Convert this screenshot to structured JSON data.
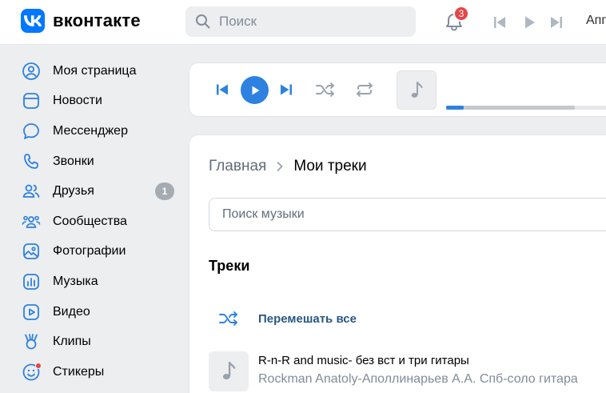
{
  "brand": {
    "name": "вконтакте",
    "accent": "#0077ff"
  },
  "header": {
    "search_placeholder": "Поиск",
    "notifications_count": "3",
    "app_label": "Апп"
  },
  "sidebar": {
    "items": [
      {
        "label": "Моя страница",
        "icon": "user-circle-icon"
      },
      {
        "label": "Новости",
        "icon": "news-icon"
      },
      {
        "label": "Мессенджер",
        "icon": "message-icon"
      },
      {
        "label": "Звонки",
        "icon": "phone-icon"
      },
      {
        "label": "Друзья",
        "icon": "friends-icon",
        "badge": "1"
      },
      {
        "label": "Сообщества",
        "icon": "communities-icon"
      },
      {
        "label": "Фотографии",
        "icon": "photo-icon"
      },
      {
        "label": "Музыка",
        "icon": "music-icon"
      },
      {
        "label": "Видео",
        "icon": "video-icon"
      },
      {
        "label": "Клипы",
        "icon": "clips-icon"
      },
      {
        "label": "Стикеры",
        "icon": "sticker-icon"
      }
    ]
  },
  "player": {
    "progress": 0.1,
    "buffered": 0.73
  },
  "main": {
    "breadcrumb_home": "Главная",
    "breadcrumb_current": "Мои треки",
    "search_placeholder": "Поиск музыки",
    "section_title": "Треки",
    "shuffle_label": "Перемешать все",
    "tracks": [
      {
        "title": "R-n-R and music- без вст и три гитары",
        "artist": "Rockman Anatoly-Аполлинарьев А.А. Спб-соло гитара"
      }
    ]
  }
}
